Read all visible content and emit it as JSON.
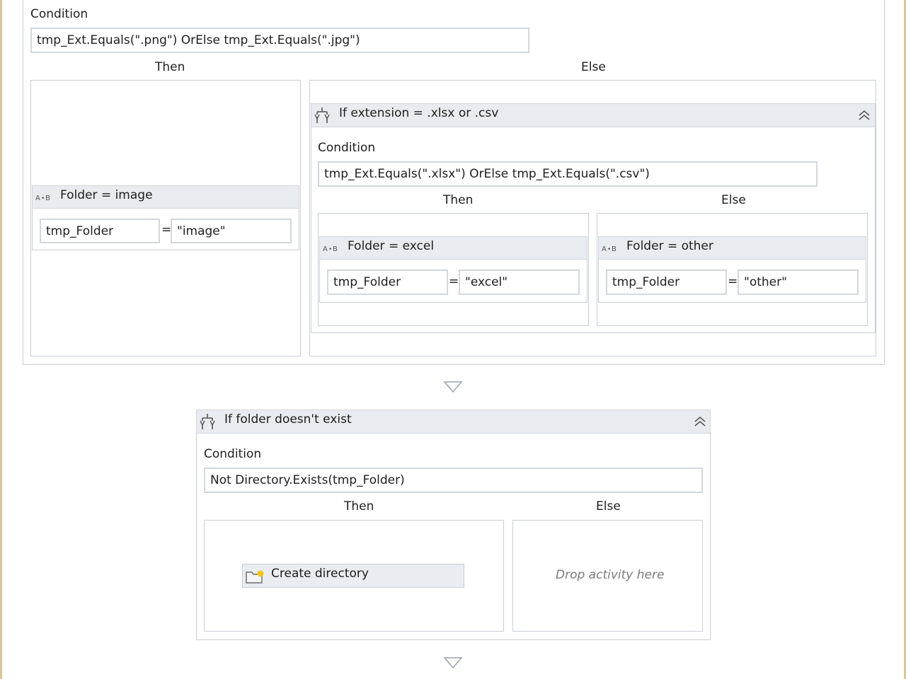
{
  "outer_if": {
    "condition_label": "Condition",
    "condition_value": "tmp_Ext.Equals(\".png\") OrElse tmp_Ext.Equals(\".jpg\")",
    "then_label": "Then",
    "else_label": "Else",
    "then_assign": {
      "title": "Folder = image",
      "variable": "tmp_Folder",
      "operator": "=",
      "value": "\"image\""
    },
    "else_if": {
      "title": "If extension = .xlsx or .csv",
      "condition_label": "Condition",
      "condition_value": "tmp_Ext.Equals(\".xlsx\") OrElse tmp_Ext.Equals(\".csv\")",
      "then_label": "Then",
      "else_label": "Else",
      "then_assign": {
        "title": "Folder = excel",
        "variable": "tmp_Folder",
        "operator": "=",
        "value": "\"excel\""
      },
      "else_assign": {
        "title": "Folder = other",
        "variable": "tmp_Folder",
        "operator": "=",
        "value": "\"other\""
      }
    }
  },
  "folder_if": {
    "title": "If folder doesn't exist",
    "condition_label": "Condition",
    "condition_value": "Not Directory.Exists(tmp_Folder)",
    "then_label": "Then",
    "else_label": "Else",
    "then_activity": "Create directory",
    "else_placeholder": "Drop activity here"
  },
  "icons": {
    "if": "if-branch-icon",
    "assign": "assign-icon",
    "collapse": "collapse-chevron-icon",
    "create_directory": "folder-create-icon",
    "sequence_arrow": "drop-arrow-icon"
  }
}
